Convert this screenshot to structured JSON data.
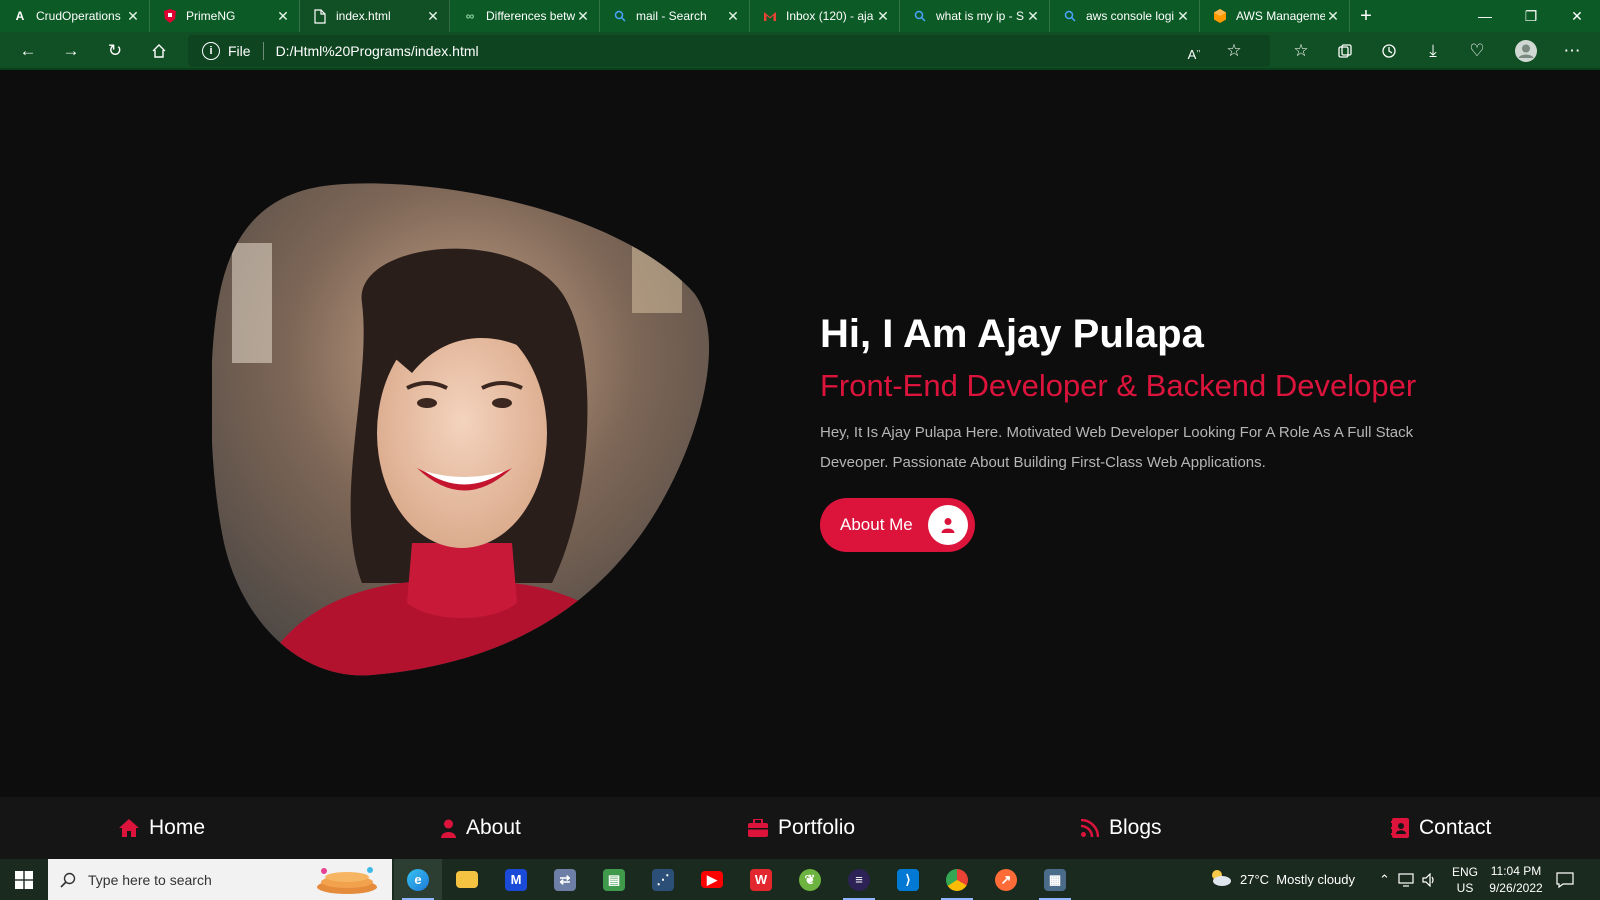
{
  "browser": {
    "tabs": [
      {
        "label": "CrudOperations",
        "icon": "angular-icon",
        "color": "#ffffff"
      },
      {
        "label": "PrimeNG",
        "icon": "primeng-icon",
        "color": "#dd0031"
      },
      {
        "label": "index.html",
        "icon": "file-icon",
        "color": "#ffffff",
        "active": true
      },
      {
        "label": "Differences betw",
        "icon": "link-icon",
        "color": "#8fd19e"
      },
      {
        "label": "mail - Search",
        "icon": "search-icon",
        "color": "#4aa3ff"
      },
      {
        "label": "Inbox (120) - aja",
        "icon": "gmail-icon",
        "color": "#ea4335"
      },
      {
        "label": "what is my ip - S",
        "icon": "search-icon",
        "color": "#4aa3ff"
      },
      {
        "label": "aws console logi",
        "icon": "search-icon",
        "color": "#4aa3ff"
      },
      {
        "label": "AWS Manageme",
        "icon": "aws-icon",
        "color": "#ff9900"
      }
    ],
    "address": {
      "scheme": "File",
      "url": "D:/Html%20Programs/index.html"
    }
  },
  "hero": {
    "title": "Hi, I Am Ajay Pulapa",
    "subtitle": "Front-End Developer & Backend Developer",
    "description": "Hey, It Is Ajay Pulapa Here. Motivated Web Developer Looking For A Role As A Full Stack Deveoper. Passionate About Building First-Class Web Applications.",
    "button_label": "About Me",
    "accent": "#dc143c"
  },
  "bottom_nav": [
    {
      "label": "Home",
      "icon": "home-icon"
    },
    {
      "label": "About",
      "icon": "user-icon"
    },
    {
      "label": "Portfolio",
      "icon": "briefcase-icon"
    },
    {
      "label": "Blogs",
      "icon": "rss-icon"
    },
    {
      "label": "Contact",
      "icon": "contact-book-icon"
    }
  ],
  "taskbar": {
    "search_placeholder": "Type here to search",
    "weather": "27°C  Mostly cloudy",
    "lang_top": "ENG",
    "lang_bottom": "US",
    "time": "11:04 PM",
    "date": "9/26/2022"
  }
}
